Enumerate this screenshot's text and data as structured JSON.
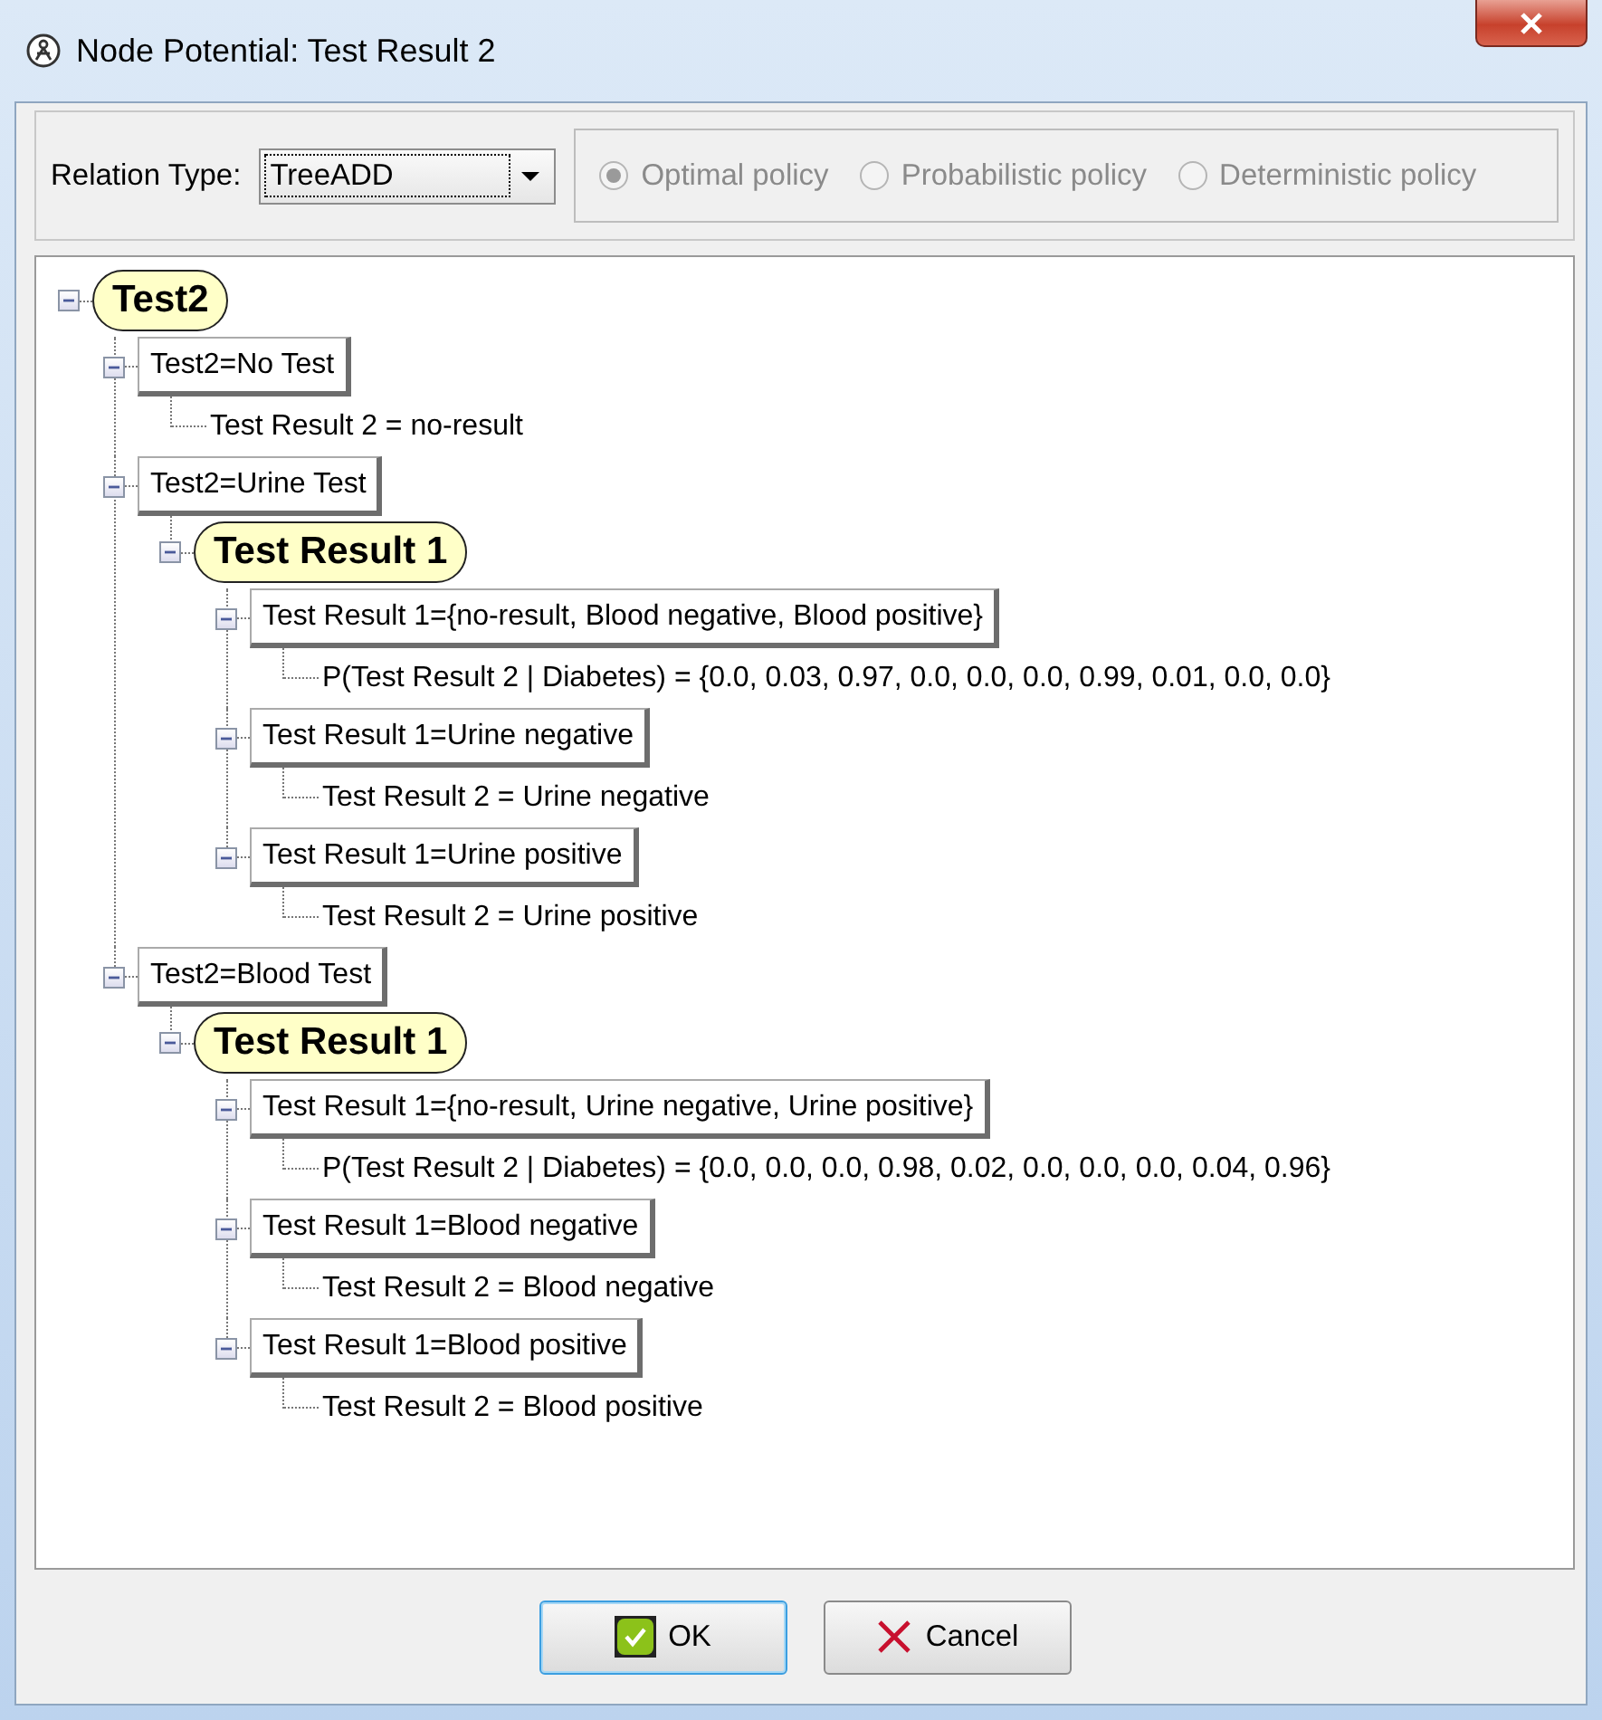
{
  "window": {
    "title": "Node Potential: Test Result 2"
  },
  "toolbar": {
    "relation_type_label": "Relation Type:",
    "relation_type": "TreeADD",
    "policies": [
      {
        "label": "Optimal policy",
        "selected": true,
        "disabled": true
      },
      {
        "label": "Probabilistic policy",
        "selected": false,
        "disabled": true
      },
      {
        "label": "Deterministic policy",
        "selected": false,
        "disabled": true
      }
    ]
  },
  "tree": [
    {
      "kind": "variable",
      "label": "Test2",
      "expanded": true,
      "children": [
        {
          "kind": "branch",
          "label": "Test2=No Test",
          "expanded": true,
          "children": [
            {
              "kind": "leaf",
              "label": "Test Result 2 = no-result"
            }
          ]
        },
        {
          "kind": "branch",
          "label": "Test2=Urine Test",
          "expanded": true,
          "children": [
            {
              "kind": "variable",
              "label": "Test Result 1",
              "expanded": true,
              "children": [
                {
                  "kind": "branch",
                  "label": "Test Result 1={no-result, Blood negative, Blood positive}",
                  "expanded": true,
                  "children": [
                    {
                      "kind": "leaf",
                      "label": "P(Test Result 2 | Diabetes) = {0.0, 0.03, 0.97, 0.0, 0.0, 0.0, 0.99, 0.01, 0.0, 0.0}"
                    }
                  ]
                },
                {
                  "kind": "branch",
                  "label": "Test Result 1=Urine negative",
                  "expanded": true,
                  "children": [
                    {
                      "kind": "leaf",
                      "label": "Test Result 2 = Urine negative"
                    }
                  ]
                },
                {
                  "kind": "branch",
                  "label": "Test Result 1=Urine positive",
                  "expanded": true,
                  "children": [
                    {
                      "kind": "leaf",
                      "label": "Test Result 2 = Urine positive"
                    }
                  ]
                }
              ]
            }
          ]
        },
        {
          "kind": "branch",
          "label": "Test2=Blood Test",
          "expanded": true,
          "children": [
            {
              "kind": "variable",
              "label": "Test Result 1",
              "expanded": true,
              "children": [
                {
                  "kind": "branch",
                  "label": "Test Result 1={no-result, Urine negative, Urine positive}",
                  "expanded": true,
                  "children": [
                    {
                      "kind": "leaf",
                      "label": "P(Test Result 2 | Diabetes) = {0.0, 0.0, 0.0, 0.98, 0.02, 0.0, 0.0, 0.0, 0.04, 0.96}"
                    }
                  ]
                },
                {
                  "kind": "branch",
                  "label": "Test Result 1=Blood negative",
                  "expanded": true,
                  "children": [
                    {
                      "kind": "leaf",
                      "label": "Test Result 2 = Blood negative"
                    }
                  ]
                },
                {
                  "kind": "branch",
                  "label": "Test Result 1=Blood positive",
                  "expanded": true,
                  "children": [
                    {
                      "kind": "leaf",
                      "label": "Test Result 2 = Blood positive"
                    }
                  ]
                }
              ]
            }
          ]
        }
      ]
    }
  ],
  "buttons": [
    {
      "kind": "ok",
      "label": "OK"
    },
    {
      "kind": "cancel",
      "label": "Cancel"
    }
  ]
}
